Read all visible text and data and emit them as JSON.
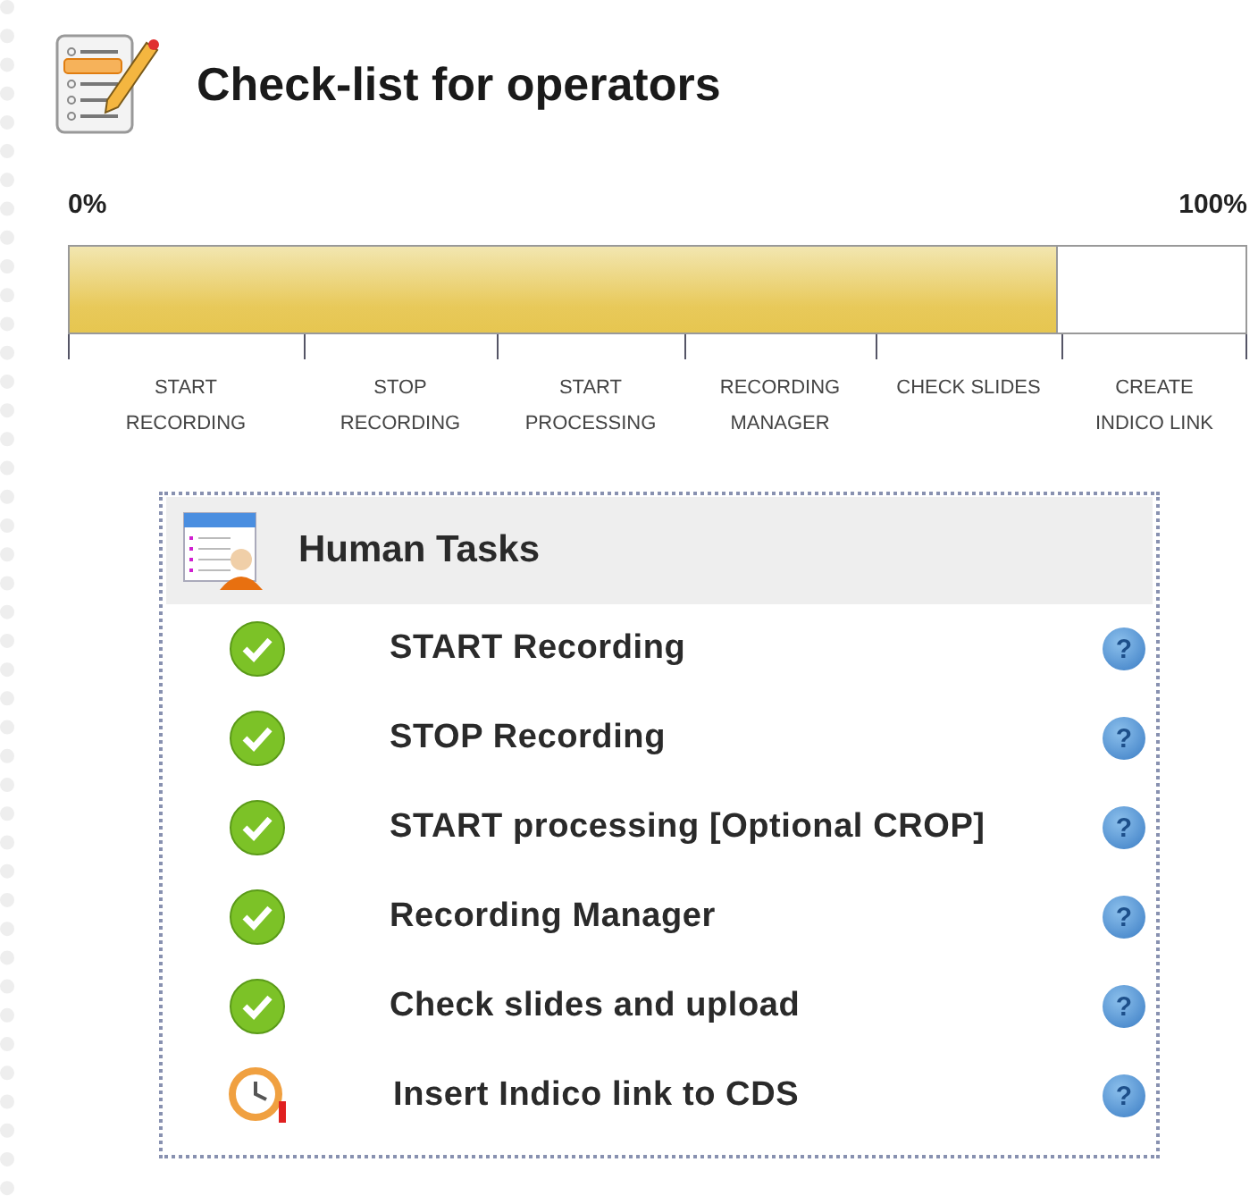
{
  "title": "Check-list for operators",
  "progress": {
    "min_label": "0%",
    "max_label": "100%",
    "level": 0.84,
    "stages": [
      {
        "label": "START RECORDING"
      },
      {
        "label": "STOP RECORDING"
      },
      {
        "label": "START PROCESSING"
      },
      {
        "label": "RECORDING MANAGER"
      },
      {
        "label": "CHECK SLIDES"
      },
      {
        "label": "CREATE INDICO LINK"
      }
    ]
  },
  "tasks_panel": {
    "title": "Human Tasks",
    "tasks": [
      {
        "label": "START Recording",
        "kind": "done",
        "help": "?"
      },
      {
        "label": "STOP Recording",
        "kind": "done",
        "help": "?"
      },
      {
        "label": "START processing [Optional CROP]",
        "kind": "done",
        "help": "?"
      },
      {
        "label": "Recording Manager",
        "kind": "done",
        "help": "?"
      },
      {
        "label": "Check slides and upload",
        "kind": "done",
        "help": "?"
      },
      {
        "label": "Insert Indico link to CDS",
        "kind": "pending",
        "help": "?"
      }
    ]
  }
}
